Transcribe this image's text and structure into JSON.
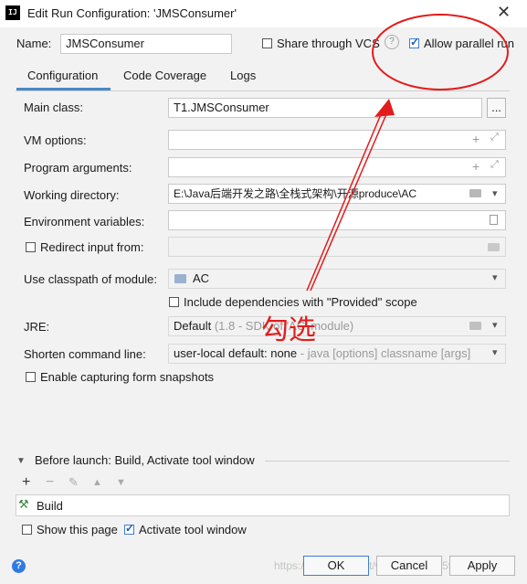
{
  "window": {
    "title": "Edit Run Configuration: 'JMSConsumer'",
    "app_icon": "IJ"
  },
  "header": {
    "name_label": "Name:",
    "name_value": "JMSConsumer",
    "share_label": "Share through VCS",
    "help": "?",
    "parallel_label": "Allow parallel run"
  },
  "tabs": [
    "Configuration",
    "Code Coverage",
    "Logs"
  ],
  "form": {
    "main_class_label": "Main class:",
    "main_class_value": "T1.JMSConsumer",
    "browse": "...",
    "vm_label": "VM options:",
    "program_args_label": "Program arguments:",
    "workdir_label": "Working directory:",
    "workdir_value": "E:\\Java后端开发之路\\全栈式架构\\开源produce\\AC",
    "env_label": "Environment variables:",
    "redirect_label": "Redirect input from:",
    "module_label": "Use classpath of module:",
    "module_value": "AC",
    "include_deps_label": "Include dependencies with \"Provided\" scope",
    "jre_label": "JRE:",
    "jre_value": "Default",
    "jre_hint": "(1.8 - SDK of 'AC' module)",
    "shorten_label": "Shorten command line:",
    "shorten_value": "user-local default: none",
    "shorten_hint": "- java [options] classname [args]",
    "snapshots_label": "Enable capturing form snapshots"
  },
  "before_launch": {
    "title": "Before launch: Build, Activate tool window",
    "tools": [
      "+",
      "−",
      "✎",
      "▲",
      "▼"
    ],
    "item": "Build",
    "show_page_label": "Show this page",
    "activate_label": "Activate tool window"
  },
  "footer": {
    "help": "?",
    "ok": "OK",
    "cancel": "Cancel",
    "apply": "Apply",
    "watermark": "https://blog.csdn.net/weixin_43859595"
  },
  "annotation": {
    "text": "勾选",
    "color": "#e21c1c"
  }
}
